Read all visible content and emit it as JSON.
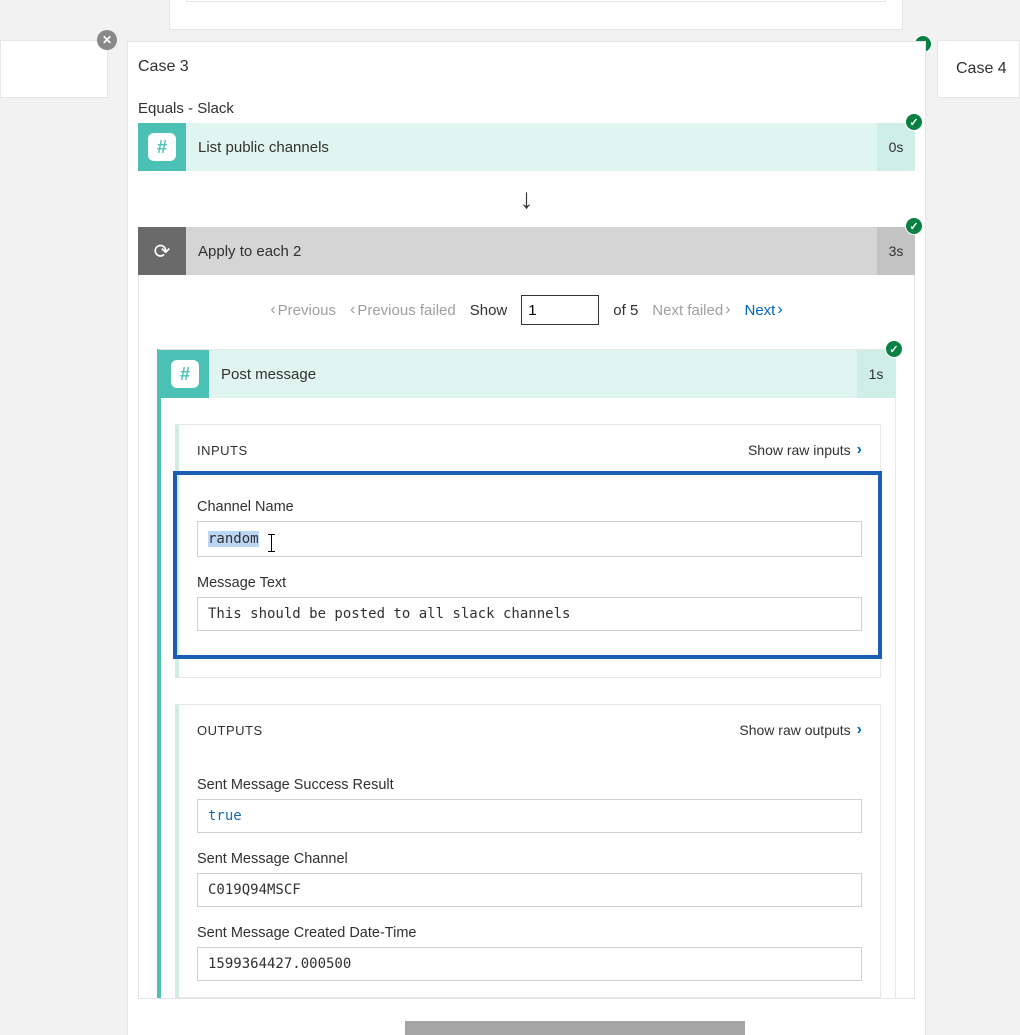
{
  "left": {},
  "case3": {
    "title": "Case 3",
    "condition": "Equals - Slack"
  },
  "case4": {
    "title": "Case 4"
  },
  "step_list": {
    "label": "List public channels",
    "time": "0s"
  },
  "step_loop": {
    "label": "Apply to each 2",
    "time": "3s"
  },
  "pager": {
    "previous": "Previous",
    "previous_failed": "Previous failed",
    "show": "Show",
    "value": "1",
    "of_total": "of 5",
    "next_failed": "Next failed",
    "next": "Next"
  },
  "step_post": {
    "label": "Post message",
    "time": "1s"
  },
  "inputs": {
    "title": "INPUTS",
    "raw_link": "Show raw inputs",
    "channel_label": "Channel Name",
    "channel_value": "random",
    "message_label": "Message Text",
    "message_value": "This should be posted to all slack channels"
  },
  "outputs": {
    "title": "OUTPUTS",
    "raw_link": "Show raw outputs",
    "success_label": "Sent Message Success Result",
    "success_value": "true",
    "channel_label": "Sent Message Channel",
    "channel_value": "C019Q94MSCF",
    "created_label": "Sent Message Created Date-Time",
    "created_value": "1599364427.000500"
  },
  "icons": {
    "hash": "#",
    "loop": "⟳",
    "close": "✕",
    "check": "✓",
    "down_arrow": "↓",
    "chev_right": "›",
    "chev_left": "‹"
  }
}
